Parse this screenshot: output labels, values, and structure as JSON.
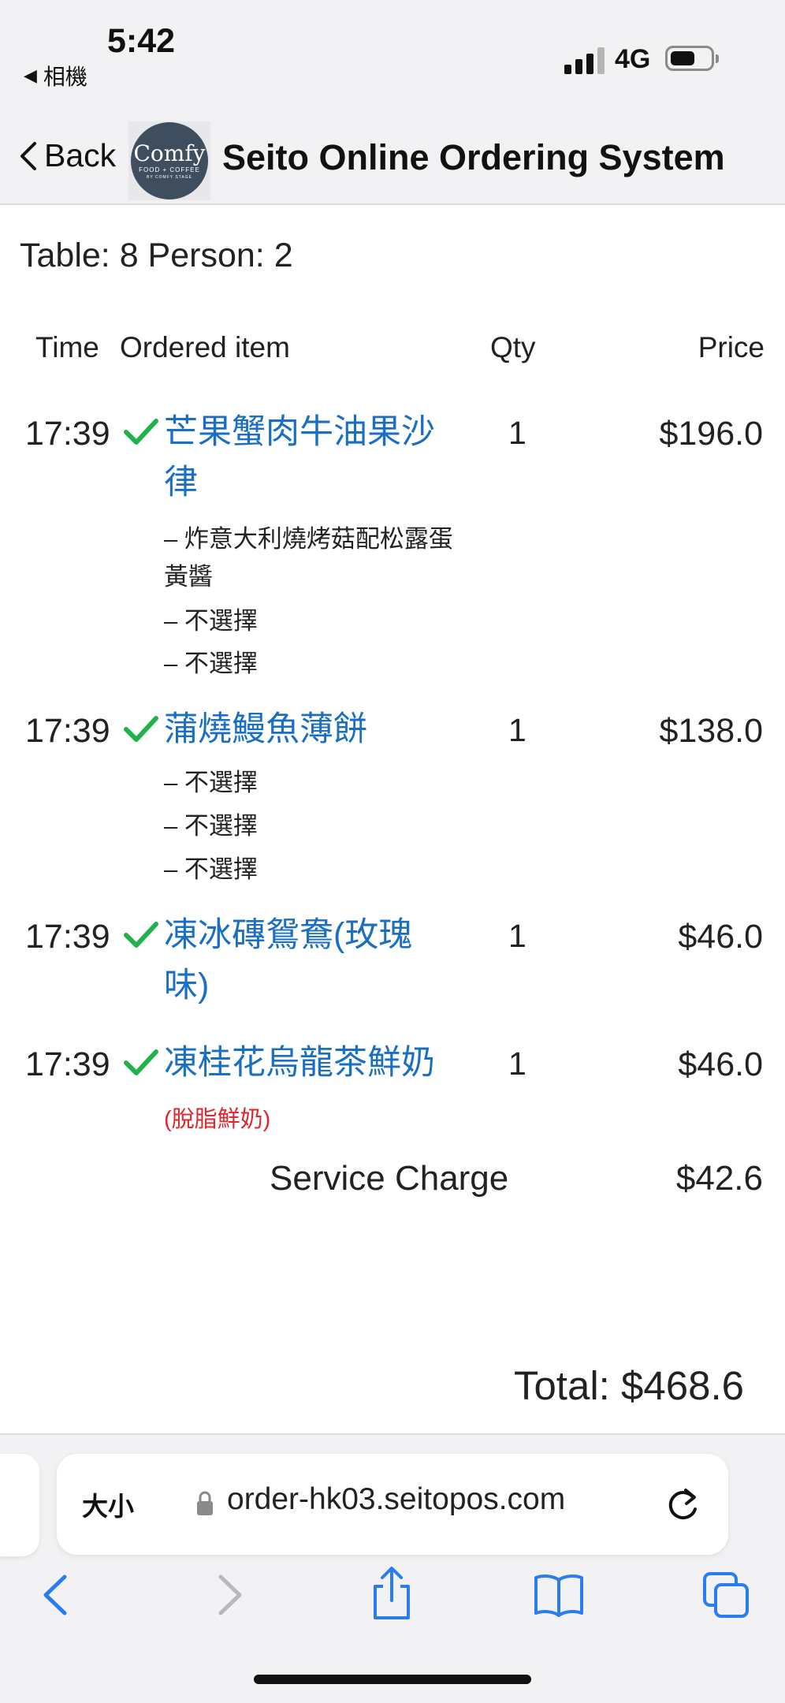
{
  "status": {
    "time": "5:42",
    "back_app": "相機",
    "network": "4G"
  },
  "nav": {
    "back_label": "Back",
    "title": "Seito Online Ordering System",
    "logo": {
      "name": "Comfy",
      "sub": "FOOD + COFFEE",
      "sub2": "BY COMFY STAGE"
    }
  },
  "table_info": "Table: 8 Person: 2",
  "headers": {
    "time": "Time",
    "item": "Ordered item",
    "qty": "Qty",
    "price": "Price"
  },
  "orders": [
    {
      "time": "17:39",
      "name": "芒果蟹肉牛油果沙律",
      "qty": "1",
      "price": "$196.0",
      "options": [
        "– 炸意大利燒烤菇配松露蛋黃醬",
        "– 不選擇",
        "– 不選擇"
      ]
    },
    {
      "time": "17:39",
      "name": "蒲燒鰻魚薄餅",
      "qty": "1",
      "price": "$138.0",
      "options": [
        "– 不選擇",
        "– 不選擇",
        "– 不選擇"
      ]
    },
    {
      "time": "17:39",
      "name": "凍冰磚鴛鴦(玫瑰味)",
      "qty": "1",
      "price": "$46.0",
      "options": []
    },
    {
      "time": "17:39",
      "name": "凍桂花烏龍茶鮮奶",
      "qty": "1",
      "price": "$46.0",
      "options": [],
      "note": "(脫脂鮮奶)"
    }
  ],
  "service_charge": {
    "label": "Service Charge",
    "value": "$42.6"
  },
  "total": "Total: $468.6",
  "browser": {
    "text_size": "大小",
    "url": "order-hk03.seitopos.com"
  },
  "colors": {
    "accent": "#1a6fc2",
    "check": "#22b24c",
    "note": "#e0262a",
    "ios_blue": "#2a7df0"
  }
}
